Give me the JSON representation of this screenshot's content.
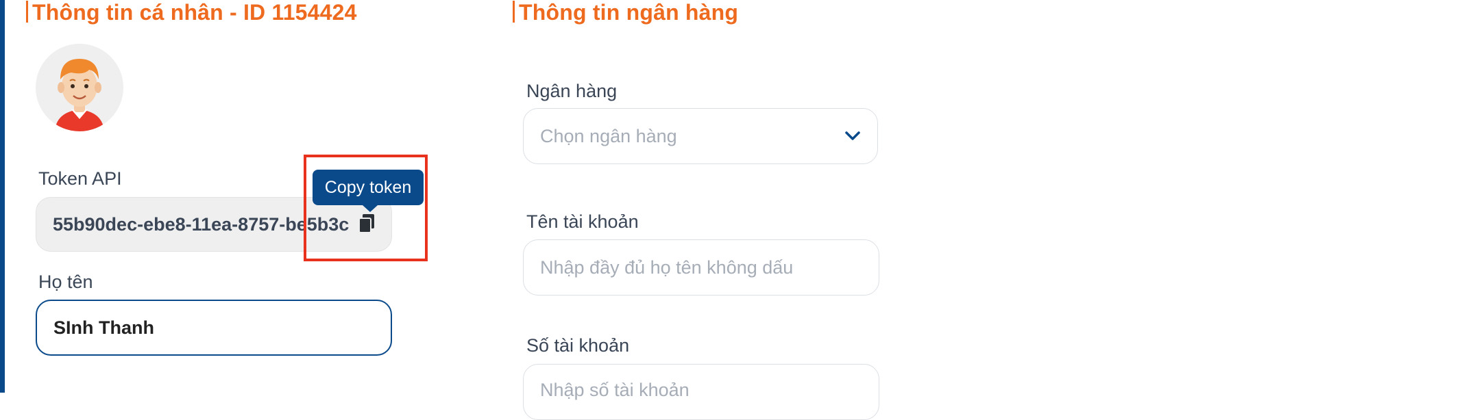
{
  "personal": {
    "title": "Thông tin cá nhân - ID 1154424",
    "token_label": "Token API",
    "token_value": "55b90dec-ebe8-11ea-8757-be5b3c",
    "copy_tooltip": "Copy token",
    "name_label": "Họ tên",
    "name_value": "SInh Thanh"
  },
  "bank": {
    "title": "Thông tin ngân hàng",
    "bank_label": "Ngân hàng",
    "bank_placeholder": "Chọn ngân hàng",
    "account_name_label": "Tên tài khoản",
    "account_name_placeholder": "Nhập đầy đủ họ tên không dấu",
    "account_number_label": "Số tài khoản",
    "account_number_placeholder": "Nhập số tài khoản"
  },
  "colors": {
    "accent_orange": "#ee6a1e",
    "brand_blue": "#0b4a8a",
    "highlight_red": "#e8321e"
  },
  "icons": [
    "avatar",
    "copy-icon",
    "chevron-down-icon"
  ]
}
